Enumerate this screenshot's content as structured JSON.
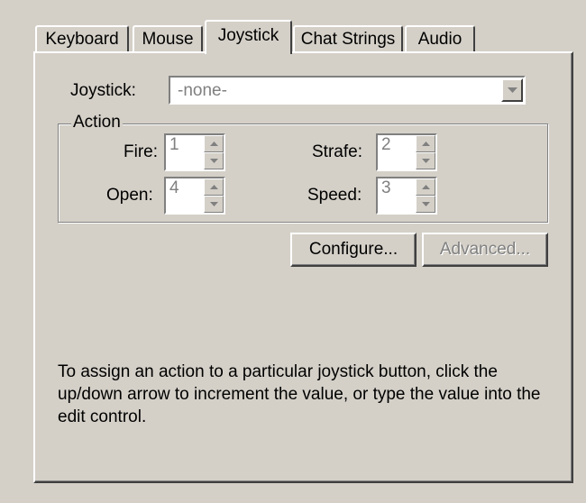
{
  "tabs": [
    {
      "label": "Keyboard",
      "active": false
    },
    {
      "label": "Mouse",
      "active": false
    },
    {
      "label": "Joystick",
      "active": true
    },
    {
      "label": "Chat Strings",
      "active": false
    },
    {
      "label": "Audio",
      "active": false
    }
  ],
  "joystick": {
    "label": "Joystick:",
    "value": "-none-",
    "dropdown_icon": "chevron-down-icon"
  },
  "action_group": {
    "title": "Action",
    "fire": {
      "label": "Fire:",
      "value": "1"
    },
    "strafe": {
      "label": "Strafe:",
      "value": "2"
    },
    "open": {
      "label": "Open:",
      "value": "4"
    },
    "speed": {
      "label": "Speed:",
      "value": "3"
    }
  },
  "buttons": {
    "configure": "Configure...",
    "advanced": "Advanced..."
  },
  "help_text": "To assign an action to a particular joystick button, click the up/down arrow to increment the value, or type the value into the edit control.",
  "colors": {
    "face": "#d4d0c8",
    "disabled_text": "#808080"
  }
}
